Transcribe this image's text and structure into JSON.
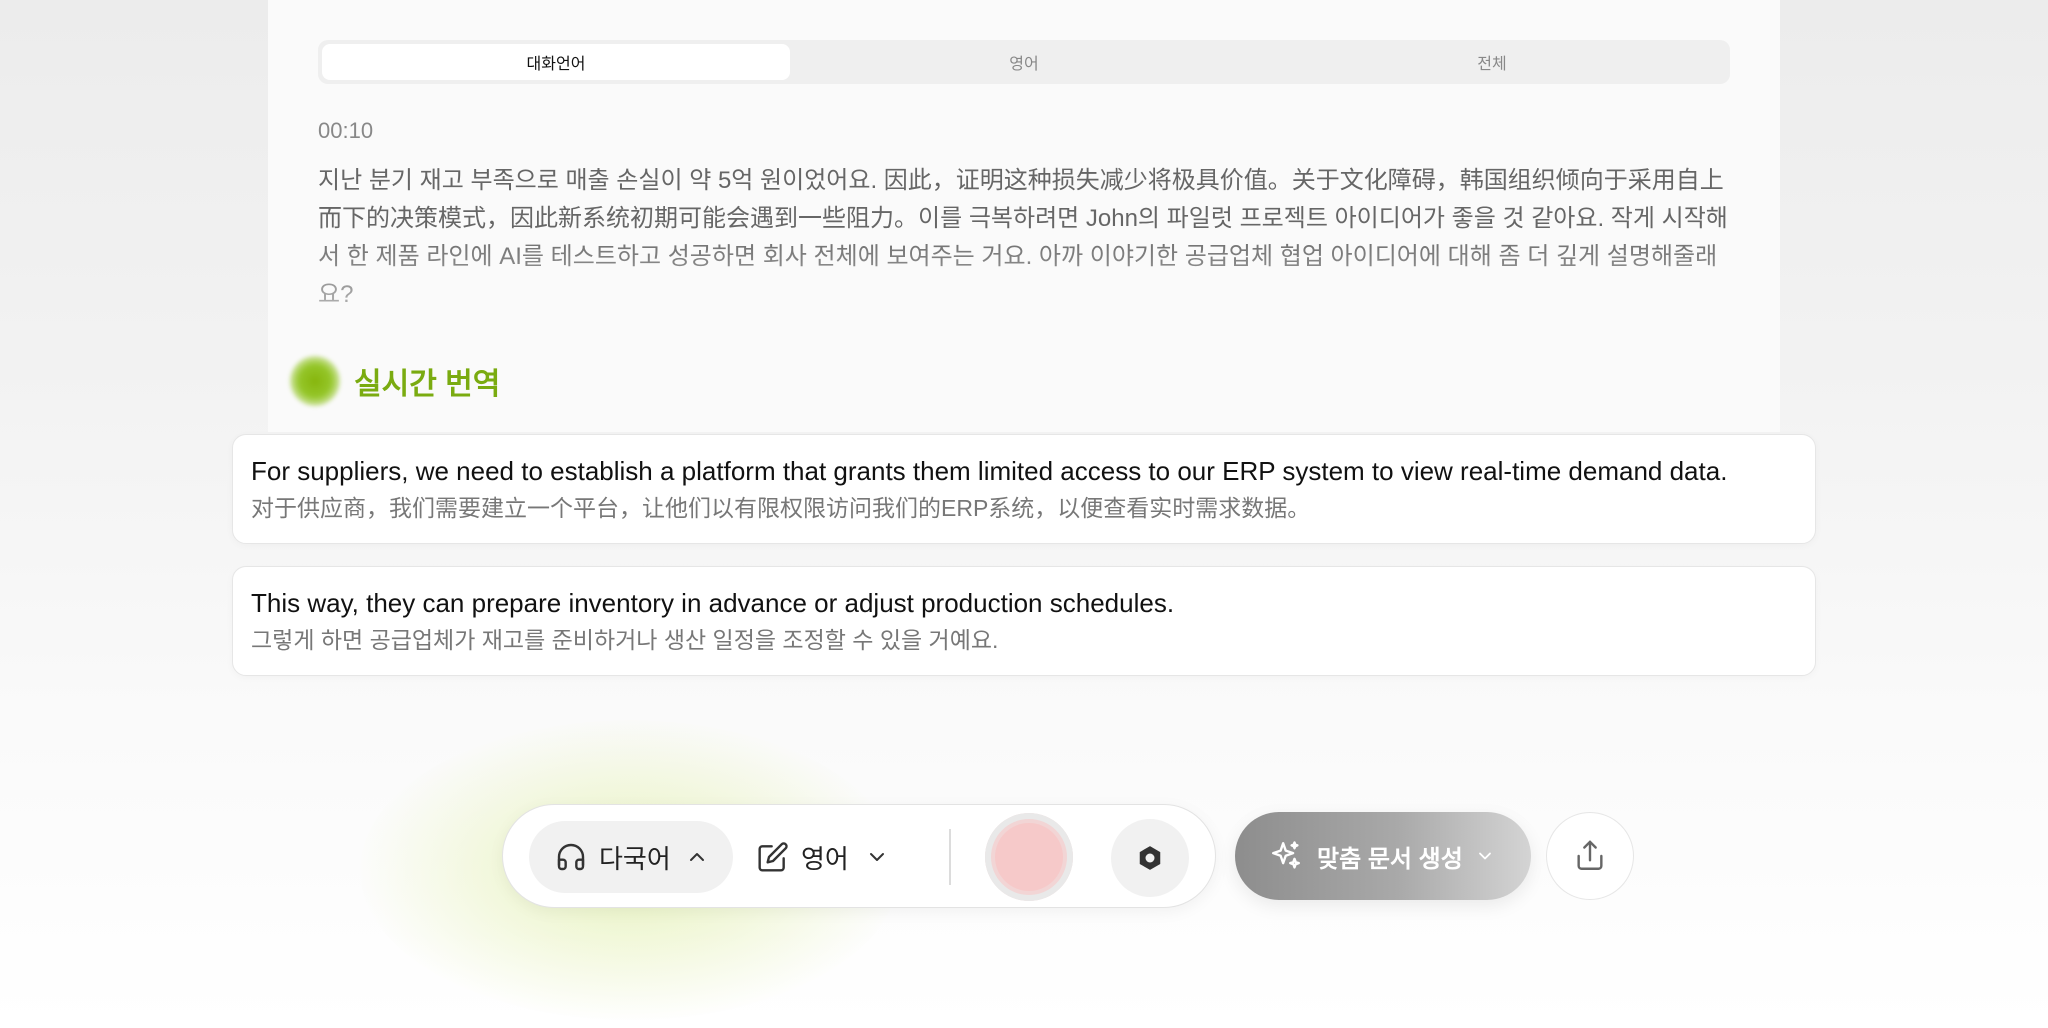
{
  "tabs": [
    {
      "label": "대화언어",
      "active": true
    },
    {
      "label": "영어",
      "active": false
    },
    {
      "label": "전체",
      "active": false
    }
  ],
  "transcript": {
    "timestamp": "00:10",
    "text": "지난 분기 재고 부족으로 매출 손실이 약 5억 원이었어요. 因此，证明这种损失减少将极具价值。关于文化障碍，韩国组织倾向于采用自上而下的决策模式，因此新系统初期可能会遇到一些阻力。이를 극복하려면 John의 파일럿 프로젝트 아이디어가 좋을 것 같아요. 작게 시작해서 한 제품 라인에 AI를 테스트하고 성공하면 회사 전체에 보여주는 거요. 아까 이야기한 공급업체 협업 아이디어에 대해 좀 더 깊게 설명해줄래요?"
  },
  "realtime": {
    "title": "실시간 번역",
    "accent_color": "#7aab10",
    "items": [
      {
        "primary": "For suppliers, we need to establish a platform that grants them limited access to our ERP system to view real-time demand data.",
        "secondary": "对于供应商，我们需要建立一个平台，让他们以有限权限访问我们的ERP系统，以便查看实时需求数据。"
      },
      {
        "primary": "This way, they can prepare inventory in advance or adjust production schedules.",
        "secondary": "그렇게 하면 공급업체가 재고를 준비하거나 생산 일정을 조정할 수 있을 거예요."
      }
    ]
  },
  "toolbar": {
    "source_language": {
      "label": "다국어",
      "icon": "headphones-icon",
      "chevron": "chevron-up-icon"
    },
    "target_language": {
      "label": "영어",
      "icon": "edit-icon",
      "chevron": "chevron-down-icon"
    },
    "record_icon": "record-icon",
    "settings_icon": "hexagon-settings-icon",
    "record_color": "#f6c9c9"
  },
  "doc_button": {
    "label": "맞춤 문서 생성",
    "icon": "sparkle-icon"
  },
  "share_icon": "share-icon"
}
